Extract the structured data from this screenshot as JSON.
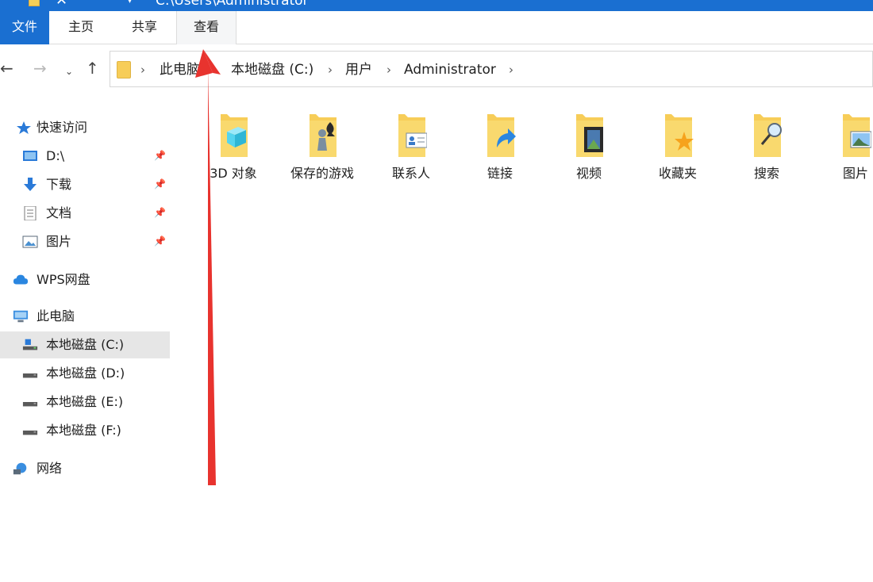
{
  "titlebar": {
    "path": "C:\\Users\\Administrator"
  },
  "ribbon": {
    "tabs": [
      "文件",
      "主页",
      "共享",
      "查看"
    ]
  },
  "address": {
    "crumbs": [
      "此电脑",
      "本地磁盘 (C:)",
      "用户",
      "Administrator"
    ]
  },
  "sidebar": {
    "quick_access": "快速访问",
    "pinned": [
      {
        "label": "D:\\",
        "icon": "drive-d-icon"
      },
      {
        "label": "下载",
        "icon": "download-icon"
      },
      {
        "label": "文档",
        "icon": "document-icon"
      },
      {
        "label": "图片",
        "icon": "picture-icon"
      }
    ],
    "wps": "WPS网盘",
    "this_pc": "此电脑",
    "drives": [
      "本地磁盘 (C:)",
      "本地磁盘 (D:)",
      "本地磁盘 (E:)",
      "本地磁盘 (F:)"
    ],
    "network": "网络"
  },
  "folders": [
    "3D 对象",
    "保存的游戏",
    "联系人",
    "链接",
    "视频",
    "收藏夹",
    "搜索",
    "图片"
  ],
  "colors": {
    "accent": "#1a6fd1",
    "folder": "#f7cd58",
    "arrow": "#e8332e"
  }
}
